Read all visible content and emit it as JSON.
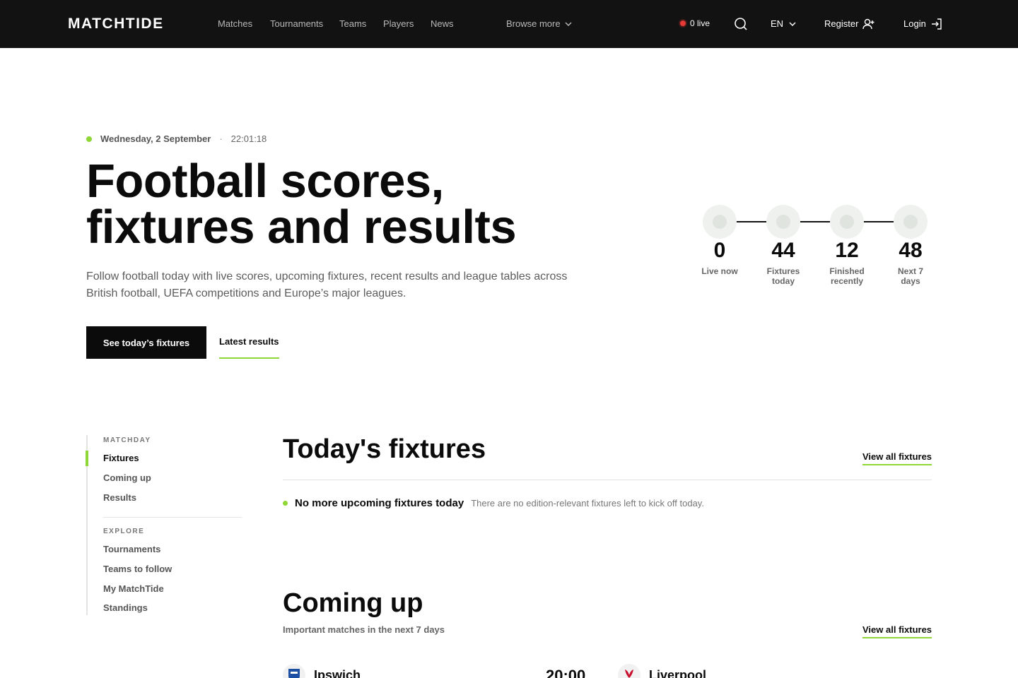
{
  "nav": {
    "logo": "MATCHTIDE",
    "links": [
      "Matches",
      "Tournaments",
      "Teams",
      "Players",
      "News"
    ],
    "browse_more": "Browse more",
    "live": "0 live",
    "language": "EN",
    "register": "Register",
    "login": "Login"
  },
  "hero": {
    "date": "Wednesday, 2 September",
    "separator": "·",
    "time": "22:01:18",
    "title_line1": "Football scores,",
    "title_line2": "fixtures and results",
    "description": "Follow football today with live scores, upcoming fixtures, recent results and league tables across British football, UEFA competitions and Europe’s major leagues.",
    "primary_button": "See today’s fixtures",
    "secondary_link": "Latest results"
  },
  "stats": [
    {
      "value": "0",
      "label_line1": "Live now",
      "label_line2": ""
    },
    {
      "value": "44",
      "label_line1": "Fixtures",
      "label_line2": "today"
    },
    {
      "value": "12",
      "label_line1": "Finished",
      "label_line2": "recently"
    },
    {
      "value": "48",
      "label_line1": "Next 7",
      "label_line2": "days"
    }
  ],
  "sidebar": {
    "matchday_heading": "MATCHDAY",
    "matchday_items": [
      "Fixtures",
      "Coming up",
      "Results"
    ],
    "explore_heading": "EXPLORE",
    "explore_items": [
      "Tournaments",
      "Teams to follow",
      "My MatchTide",
      "Standings"
    ]
  },
  "todays_fixtures": {
    "title": "Today's fixtures",
    "view_all": "View all fixtures",
    "empty_title": "No more upcoming fixtures today",
    "empty_desc": "There are no edition-relevant fixtures left to kick off today."
  },
  "coming_up": {
    "title": "Coming up",
    "subtitle": "Important matches in the next 7 days",
    "view_all": "View all fixtures",
    "match": {
      "home": "Ipswich",
      "kickoff": "20:00",
      "away": "Liverpool"
    }
  },
  "colors": {
    "nav_bg": "#121212",
    "accent": "#8fd637",
    "live": "#e53935",
    "text": "#0b0b0b"
  }
}
